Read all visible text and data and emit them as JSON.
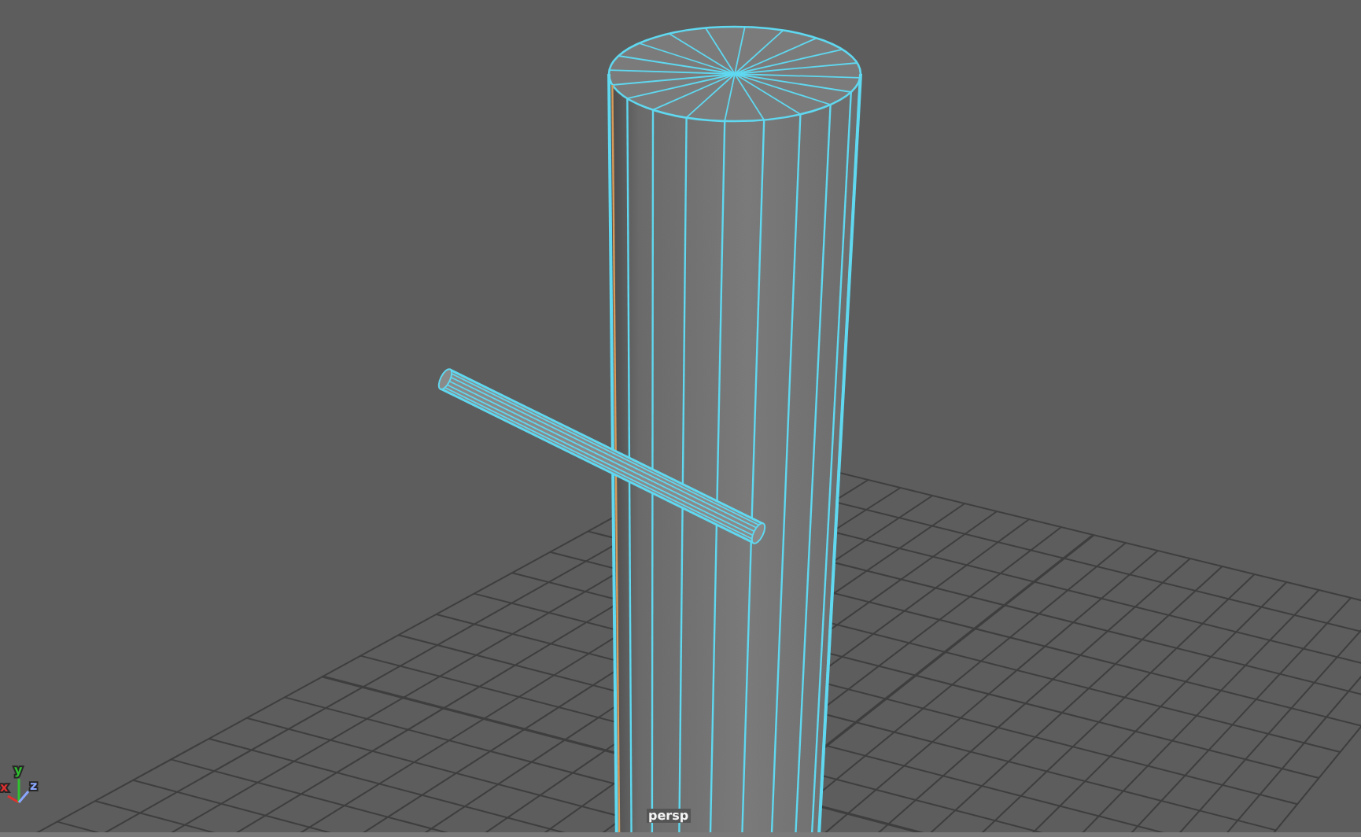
{
  "viewport": {
    "camera_label": "persp",
    "axis_labels": [
      {
        "axis": "x",
        "color": "#e03030"
      },
      {
        "axis": "y",
        "color": "#30c030"
      },
      {
        "axis": "z",
        "color": "#8aa6ff"
      }
    ]
  }
}
